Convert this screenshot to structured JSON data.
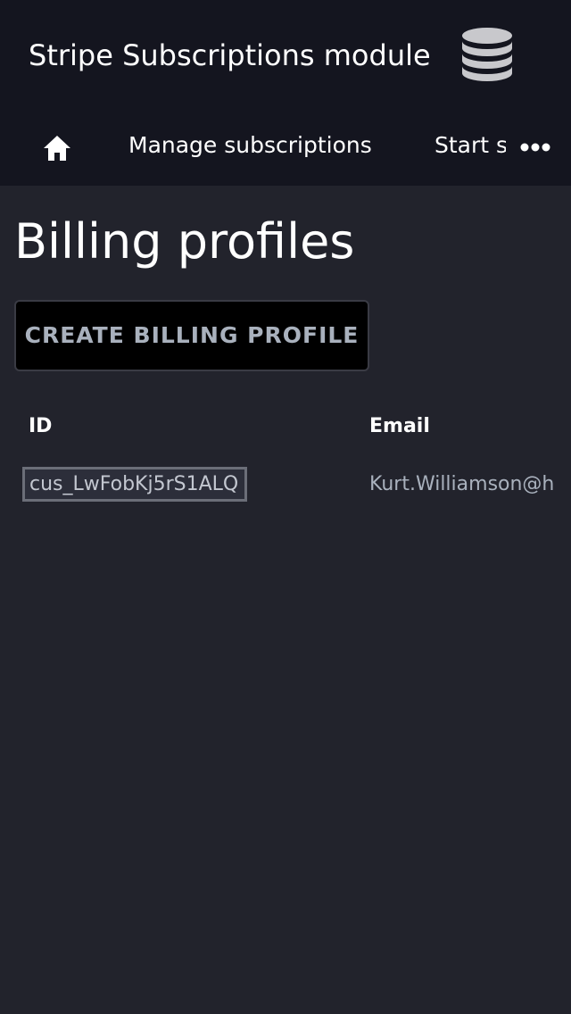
{
  "header": {
    "title": "Stripe Subscriptions module",
    "logo_icon": "database-icon"
  },
  "nav": {
    "home_icon": "home-icon",
    "items": [
      {
        "label": "Manage subscriptions"
      },
      {
        "label": "Start s"
      }
    ],
    "more_icon": "more-horizontal-icon"
  },
  "page": {
    "title": "Billing profiles",
    "create_button_label": "CREATE BILLING PROFILE"
  },
  "table": {
    "columns": [
      "ID",
      "Email"
    ],
    "rows": [
      {
        "id": "cus_LwFobKj5rS1ALQ",
        "email": "Kurt.Williamson@h"
      }
    ]
  },
  "colors": {
    "header_bg": "#14151f",
    "page_bg": "#22232c",
    "button_bg": "#000000",
    "button_text": "#a9b1bd",
    "selection_border": "#6b6e78"
  }
}
